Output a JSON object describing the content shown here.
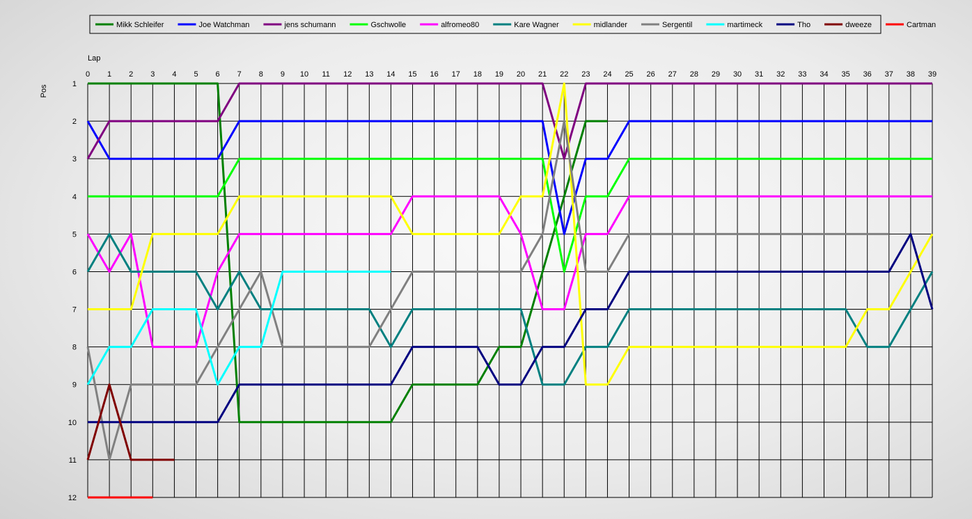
{
  "chart_data": {
    "type": "line",
    "xlabel": "Lap",
    "ylabel": "Pos",
    "xlim": [
      0,
      39
    ],
    "ylim": [
      1,
      12
    ],
    "y_inverted": true,
    "grid": true,
    "legend_position": "top",
    "x_ticks": [
      0,
      1,
      2,
      3,
      4,
      5,
      6,
      7,
      8,
      9,
      10,
      11,
      12,
      13,
      14,
      15,
      16,
      17,
      18,
      19,
      20,
      21,
      22,
      23,
      24,
      25,
      26,
      27,
      28,
      29,
      30,
      31,
      32,
      33,
      34,
      35,
      36,
      37,
      38,
      39
    ],
    "y_ticks": [
      1,
      2,
      3,
      4,
      5,
      6,
      7,
      8,
      9,
      10,
      11,
      12
    ],
    "series": [
      {
        "name": "Mikk Schleifer",
        "color": "#008000",
        "x": [
          0,
          1,
          2,
          3,
          4,
          5,
          6,
          7,
          8,
          9,
          10,
          11,
          12,
          13,
          14,
          15,
          16,
          17,
          18,
          19,
          20,
          21,
          22,
          23,
          24
        ],
        "values": [
          1,
          1,
          1,
          1,
          1,
          1,
          1,
          10,
          10,
          10,
          10,
          10,
          10,
          10,
          10,
          9,
          9,
          9,
          9,
          8,
          8,
          6,
          4,
          2,
          2
        ]
      },
      {
        "name": "Joe Watchman",
        "color": "#0000FF",
        "x": [
          0,
          1,
          2,
          3,
          4,
          5,
          6,
          7,
          8,
          9,
          10,
          11,
          12,
          13,
          14,
          15,
          16,
          17,
          18,
          19,
          20,
          21,
          22,
          23,
          24,
          25,
          26,
          27,
          28,
          29,
          30,
          31,
          32,
          33,
          34,
          35,
          36,
          37,
          38,
          39
        ],
        "values": [
          2,
          3,
          3,
          3,
          3,
          3,
          3,
          2,
          2,
          2,
          2,
          2,
          2,
          2,
          2,
          2,
          2,
          2,
          2,
          2,
          2,
          2,
          5,
          3,
          3,
          2,
          2,
          2,
          2,
          2,
          2,
          2,
          2,
          2,
          2,
          2,
          2,
          2,
          2,
          2
        ]
      },
      {
        "name": "jens  schumann",
        "color": "#800080",
        "x": [
          0,
          1,
          2,
          3,
          4,
          5,
          6,
          7,
          8,
          9,
          10,
          11,
          12,
          13,
          14,
          15,
          16,
          17,
          18,
          19,
          20,
          21,
          22,
          23,
          24,
          25,
          26,
          27,
          28,
          29,
          30,
          31,
          32,
          33,
          34,
          35,
          36,
          37,
          38,
          39
        ],
        "values": [
          3,
          2,
          2,
          2,
          2,
          2,
          2,
          1,
          1,
          1,
          1,
          1,
          1,
          1,
          1,
          1,
          1,
          1,
          1,
          1,
          1,
          1,
          3,
          1,
          1,
          1,
          1,
          1,
          1,
          1,
          1,
          1,
          1,
          1,
          1,
          1,
          1,
          1,
          1,
          1
        ]
      },
      {
        "name": "Gschwolle",
        "color": "#00FF00",
        "x": [
          0,
          1,
          2,
          3,
          4,
          5,
          6,
          7,
          8,
          9,
          10,
          11,
          12,
          13,
          14,
          15,
          16,
          17,
          18,
          19,
          20,
          21,
          22,
          23,
          24,
          25,
          26,
          27,
          28,
          29,
          30,
          31,
          32,
          33,
          34,
          35,
          36,
          37,
          38,
          39
        ],
        "values": [
          4,
          4,
          4,
          4,
          4,
          4,
          4,
          3,
          3,
          3,
          3,
          3,
          3,
          3,
          3,
          3,
          3,
          3,
          3,
          3,
          3,
          3,
          6,
          4,
          4,
          3,
          3,
          3,
          3,
          3,
          3,
          3,
          3,
          3,
          3,
          3,
          3,
          3,
          3,
          3
        ]
      },
      {
        "name": "alfromeo80",
        "color": "#FF00FF",
        "x": [
          0,
          1,
          2,
          3,
          4,
          5,
          6,
          7,
          8,
          9,
          10,
          11,
          12,
          13,
          14,
          15,
          16,
          17,
          18,
          19,
          20,
          21,
          22,
          23,
          24,
          25,
          26,
          27,
          28,
          29,
          30,
          31,
          32,
          33,
          34,
          35,
          36,
          37,
          38,
          39
        ],
        "values": [
          5,
          6,
          5,
          8,
          8,
          8,
          6,
          5,
          5,
          5,
          5,
          5,
          5,
          5,
          5,
          4,
          4,
          4,
          4,
          4,
          5,
          7,
          7,
          5,
          5,
          4,
          4,
          4,
          4,
          4,
          4,
          4,
          4,
          4,
          4,
          4,
          4,
          4,
          4,
          4
        ]
      },
      {
        "name": "Kare Wagner",
        "color": "#008080",
        "x": [
          0,
          1,
          2,
          3,
          4,
          5,
          6,
          7,
          8,
          9,
          10,
          11,
          12,
          13,
          14,
          15,
          16,
          17,
          18,
          19,
          20,
          21,
          22,
          23,
          24,
          25,
          26,
          27,
          28,
          29,
          30,
          31,
          32,
          33,
          34,
          35,
          36,
          37,
          38,
          39
        ],
        "values": [
          6,
          5,
          6,
          6,
          6,
          6,
          7,
          6,
          7,
          7,
          7,
          7,
          7,
          7,
          8,
          7,
          7,
          7,
          7,
          7,
          7,
          9,
          9,
          8,
          8,
          7,
          7,
          7,
          7,
          7,
          7,
          7,
          7,
          7,
          7,
          7,
          8,
          8,
          7,
          6
        ]
      },
      {
        "name": "midlander",
        "color": "#FFFF00",
        "x": [
          0,
          1,
          2,
          3,
          4,
          5,
          6,
          7,
          8,
          9,
          10,
          11,
          12,
          13,
          14,
          15,
          16,
          17,
          18,
          19,
          20,
          21,
          22,
          23,
          24,
          25,
          26,
          27,
          28,
          29,
          30,
          31,
          32,
          33,
          34,
          35,
          36,
          37,
          38,
          39
        ],
        "values": [
          7,
          7,
          7,
          5,
          5,
          5,
          5,
          4,
          4,
          4,
          4,
          4,
          4,
          4,
          4,
          5,
          5,
          5,
          5,
          5,
          4,
          4,
          1,
          9,
          9,
          8,
          8,
          8,
          8,
          8,
          8,
          8,
          8,
          8,
          8,
          8,
          7,
          7,
          6,
          5
        ]
      },
      {
        "name": "Sergentil",
        "color": "#808080",
        "x": [
          0,
          1,
          2,
          3,
          4,
          5,
          6,
          7,
          8,
          9,
          10,
          11,
          12,
          13,
          14,
          15,
          16,
          17,
          18,
          19,
          20,
          21,
          22,
          23,
          24,
          25,
          26,
          27,
          28,
          29,
          30,
          31,
          32,
          33,
          34,
          35,
          36,
          37
        ],
        "values": [
          8,
          11,
          9,
          9,
          9,
          9,
          8,
          7,
          6,
          8,
          8,
          8,
          8,
          8,
          7,
          6,
          6,
          6,
          6,
          6,
          6,
          5,
          2,
          6,
          6,
          5,
          5,
          5,
          5,
          5,
          5,
          5,
          5,
          5,
          5,
          5,
          5,
          5
        ]
      },
      {
        "name": "martimeck",
        "color": "#00FFFF",
        "x": [
          0,
          1,
          2,
          3,
          4,
          5,
          6,
          7,
          8,
          9,
          10,
          11,
          12,
          13,
          14
        ],
        "values": [
          9,
          8,
          8,
          7,
          7,
          7,
          9,
          8,
          8,
          6,
          6,
          6,
          6,
          6,
          6
        ]
      },
      {
        "name": "Tho",
        "color": "#000080",
        "x": [
          0,
          1,
          2,
          3,
          4,
          5,
          6,
          7,
          8,
          9,
          10,
          11,
          12,
          13,
          14,
          15,
          16,
          17,
          18,
          19,
          20,
          21,
          22,
          23,
          24,
          25,
          26,
          27,
          28,
          29,
          30,
          31,
          32,
          33,
          34,
          35,
          36,
          37,
          38,
          39
        ],
        "values": [
          10,
          10,
          10,
          10,
          10,
          10,
          10,
          9,
          9,
          9,
          9,
          9,
          9,
          9,
          9,
          8,
          8,
          8,
          8,
          9,
          9,
          8,
          8,
          7,
          7,
          6,
          6,
          6,
          6,
          6,
          6,
          6,
          6,
          6,
          6,
          6,
          6,
          6,
          5,
          7
        ]
      },
      {
        "name": "dweeze",
        "color": "#800000",
        "x": [
          0,
          1,
          2,
          3,
          4
        ],
        "values": [
          11,
          9,
          11,
          11,
          11
        ]
      },
      {
        "name": "Cartman",
        "color": "#FF0000",
        "x": [
          0,
          1,
          2,
          3
        ],
        "values": [
          12,
          12,
          12,
          12
        ]
      }
    ]
  }
}
